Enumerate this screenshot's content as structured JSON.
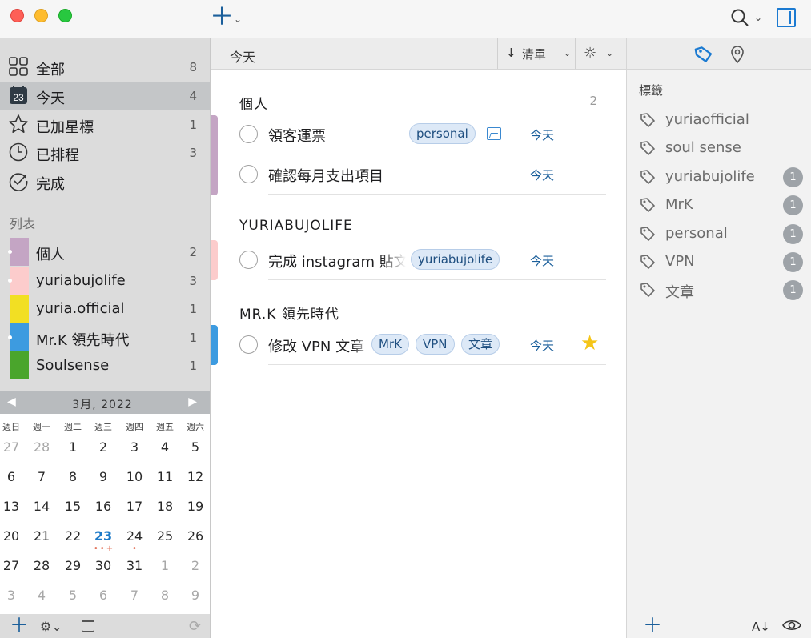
{
  "toolbar": {
    "new_task_icon": "plus-icon",
    "search_icon": "search-icon",
    "sidebar_toggle_icon": "sidebar-toggle-icon"
  },
  "sidebar": {
    "smart_lists": [
      {
        "label": "全部",
        "count": "8",
        "icon": "grid-icon"
      },
      {
        "label": "今天",
        "count": "4",
        "icon": "calendar-day-icon",
        "icon_text": "23",
        "selected": true
      },
      {
        "label": "已加星標",
        "count": "1",
        "icon": "star-icon"
      },
      {
        "label": "已排程",
        "count": "3",
        "icon": "clock-icon"
      },
      {
        "label": "完成",
        "count": "",
        "icon": "check-circle-icon"
      }
    ],
    "lists_title": "列表",
    "lists": [
      {
        "label": "個人",
        "count": "2",
        "color": "#c4a5c4"
      },
      {
        "label": "yuriabujolife",
        "count": "3",
        "color": "#fccccc"
      },
      {
        "label": "yuria.official",
        "count": "1",
        "color": "#f2df23"
      },
      {
        "label": "Mr.K 領先時代",
        "count": "1",
        "color": "#3d9be0"
      },
      {
        "label": "Soulsense",
        "count": "1",
        "color": "#4aa52c"
      }
    ]
  },
  "calendar": {
    "month_label": "3月, 2022",
    "weekdays": [
      "週日",
      "週一",
      "週二",
      "週三",
      "週四",
      "週五",
      "週六"
    ],
    "weeks": [
      [
        "27",
        "28",
        "1",
        "2",
        "3",
        "4",
        "5"
      ],
      [
        "6",
        "7",
        "8",
        "9",
        "10",
        "11",
        "12"
      ],
      [
        "13",
        "14",
        "15",
        "16",
        "17",
        "18",
        "19"
      ],
      [
        "20",
        "21",
        "22",
        "23",
        "24",
        "25",
        "26"
      ],
      [
        "27",
        "28",
        "29",
        "30",
        "31",
        "1",
        "2"
      ],
      [
        "3",
        "4",
        "5",
        "6",
        "7",
        "8",
        "9"
      ]
    ],
    "today": "23",
    "today_marks": "••+",
    "day24_marks": "•"
  },
  "main": {
    "header_title": "今天",
    "sort_label": "清單",
    "groups": [
      {
        "title": "個人",
        "count": "2",
        "color": "#c4a5c4",
        "tasks": [
          {
            "name": "領客運票",
            "tags": [
              "personal"
            ],
            "when": "今天",
            "has_image": true
          },
          {
            "name": "確認每月支出項目",
            "tags": [],
            "when": "今天"
          }
        ]
      },
      {
        "title": "YURIABUJOLIFE",
        "count": "",
        "color": "#fccccc",
        "tasks": [
          {
            "name": "完成 instagram 貼文",
            "tags": [
              "yuriabujolife"
            ],
            "when": "今天"
          }
        ]
      },
      {
        "title": "MR.K 領先時代",
        "count": "",
        "color": "#3d9be0",
        "tasks": [
          {
            "name": "修改 VPN 文章",
            "tags": [
              "MrK",
              "VPN",
              "文章"
            ],
            "when": "今天",
            "starred": true
          }
        ]
      }
    ]
  },
  "tags_panel": {
    "title": "標籤",
    "tags": [
      {
        "label": "yuriaofficial",
        "count": ""
      },
      {
        "label": "soul sense",
        "count": ""
      },
      {
        "label": "yuriabujolife",
        "count": "1"
      },
      {
        "label": "MrK",
        "count": "1"
      },
      {
        "label": "personal",
        "count": "1"
      },
      {
        "label": "VPN",
        "count": "1"
      },
      {
        "label": "文章",
        "count": "1"
      }
    ],
    "sort_label": "A↓"
  }
}
